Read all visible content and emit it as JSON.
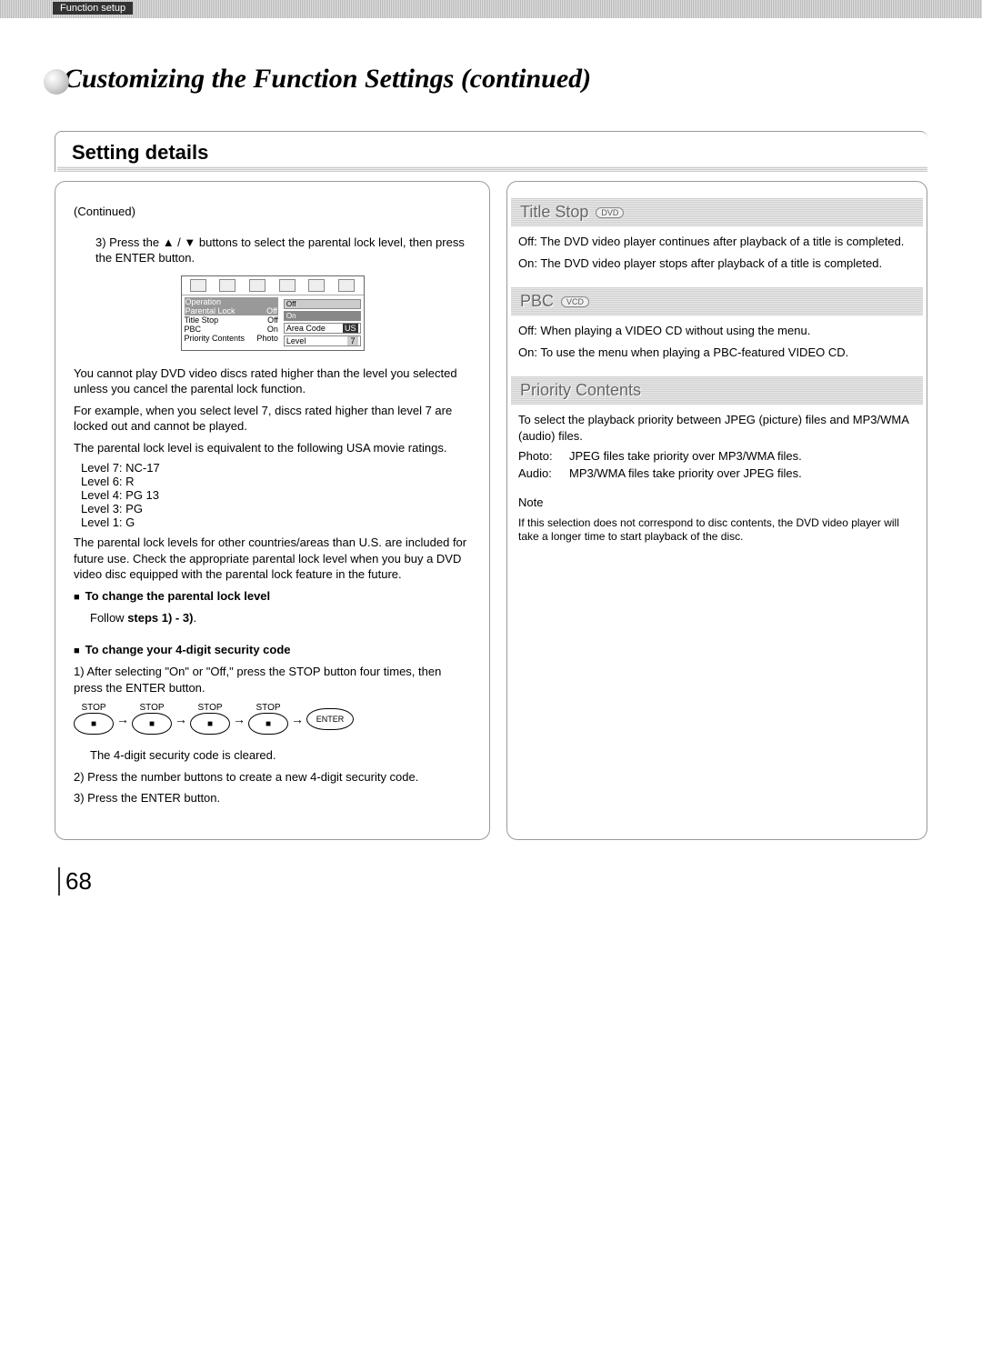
{
  "tab": "Function setup",
  "chapter_title": "Customizing the Function Settings (continued)",
  "section": "Setting details",
  "left": {
    "continued": "(Continued)",
    "step3": "3) Press the ▲ / ▼ buttons to select the parental lock level, then press the ENTER button.",
    "osd": {
      "group": "Operation",
      "rows": [
        {
          "label": "Parental Lock",
          "val": "Off"
        },
        {
          "label": "Title Stop",
          "val": "Off"
        },
        {
          "label": "PBC",
          "val": "On"
        },
        {
          "label": "Priority Contents",
          "val": "Photo"
        }
      ],
      "opt_off": "Off",
      "opt_on": "On",
      "area_label": "Area Code",
      "area_val": "US",
      "level_label": "Level",
      "level_val": "7"
    },
    "para1": "You cannot play DVD video discs rated higher than the level you selected unless you cancel the parental lock function.",
    "para2": "For example, when you select level 7, discs rated higher than level 7 are locked out and cannot be played.",
    "para3": "The parental lock level is equivalent to the following USA movie ratings.",
    "ratings": [
      "Level 7: NC-17",
      "Level 6: R",
      "Level 4: PG 13",
      "Level 3: PG",
      "Level 1: G"
    ],
    "para4": "The parental lock levels for other countries/areas than U.S. are included for future use. Check the appropriate parental lock level when you buy a DVD video disc equipped with the parental lock feature in the future.",
    "bullet1_title": "To change the parental lock level",
    "bullet1_body": "Follow steps 1) - 3).",
    "bullet2_title": "To change your 4-digit security code",
    "sc_step1": "1) After selecting \"On\" or \"Off,\" press the STOP button four times, then press the ENTER button.",
    "stop_label": "STOP",
    "enter_label": "ENTER",
    "sc_cleared": "The 4-digit security code is cleared.",
    "sc_step2": "2) Press the number buttons to create a new 4-digit security code.",
    "sc_step3": "3) Press the ENTER button."
  },
  "right": {
    "title_stop": {
      "header": "Title Stop",
      "badge": "DVD",
      "off": "Off: The DVD video player continues after playback of a title is completed.",
      "on": "On: The DVD video player stops after playback of a title is completed."
    },
    "pbc": {
      "header": "PBC",
      "badge": "VCD",
      "off": "Off: When playing a VIDEO CD without using the menu.",
      "on": "On: To use the menu when playing a PBC-featured VIDEO CD."
    },
    "priority": {
      "header": "Priority Contents",
      "intro": "To select the playback priority between JPEG (picture) files and MP3/WMA (audio) files.",
      "photo_k": "Photo:",
      "photo_v": "JPEG files take priority over MP3/WMA files.",
      "audio_k": "Audio:",
      "audio_v": "MP3/WMA files take priority over JPEG files.",
      "note_h": "Note",
      "note": "If this selection does not correspond to disc contents, the DVD video player will take a longer time to start playback of the disc."
    }
  },
  "page_num": "68"
}
